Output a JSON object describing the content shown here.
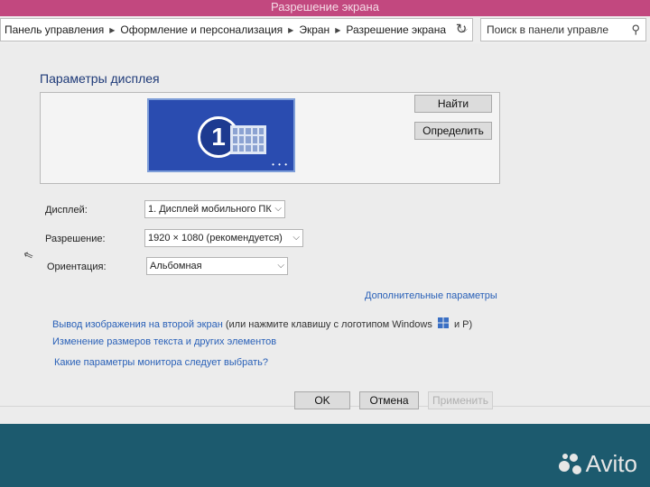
{
  "window": {
    "title": "Разрешение экрана"
  },
  "address": {
    "crumbs": [
      "Панель управления",
      "Оформление и персонализация",
      "Экран",
      "Разрешение экрана"
    ]
  },
  "search": {
    "placeholder": "Поиск в панели управле"
  },
  "section": {
    "title": "Параметры дисплея"
  },
  "preview": {
    "monitor_number": "1"
  },
  "buttons": {
    "find": "Найти",
    "identify": "Определить",
    "ok": "OK",
    "cancel": "Отмена",
    "apply": "Применить"
  },
  "fields": {
    "display_label": "Дисплей:",
    "display_value": "1. Дисплей мобильного ПК",
    "resolution_label": "Разрешение:",
    "resolution_value": "1920 × 1080 (рекомендуется)",
    "orientation_label": "Ориентация:",
    "orientation_value": "Альбомная"
  },
  "links": {
    "advanced": "Дополнительные параметры",
    "second_screen": "Вывод изображения на второй экран",
    "second_screen_hint_a": "(или нажмите клавишу с логотипом Windows",
    "second_screen_hint_b": "и P)",
    "text_size": "Изменение размеров текста и других элементов",
    "which_params": "Какие параметры монитора следует выбрать?"
  },
  "watermark": {
    "text": "Avito"
  },
  "colors": {
    "accent": "#2a61b8",
    "monitor": "#2a4cb0",
    "titlebar": "#c2487f"
  }
}
